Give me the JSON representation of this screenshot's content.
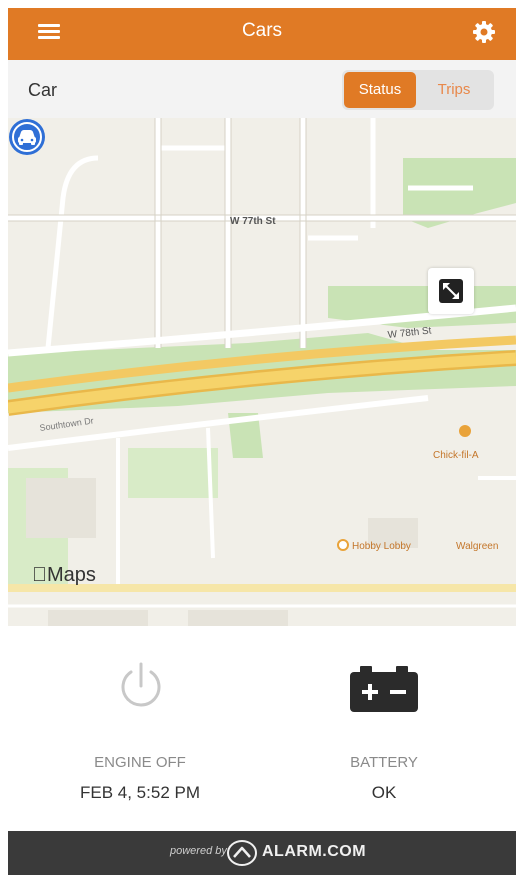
{
  "header": {
    "title": "Cars",
    "menu_icon": "menu-icon",
    "settings_icon": "gear-icon"
  },
  "subbar": {
    "label": "Car",
    "tabs": [
      {
        "label": "Status",
        "active": true
      },
      {
        "label": "Trips",
        "active": false
      }
    ]
  },
  "map": {
    "streets": [
      "W 77th St",
      "W 78th St",
      "Southtown Dr"
    ],
    "places": [
      "Chick-fil-A",
      "Hobby Lobby",
      "Walgreen"
    ],
    "attribution": "Maps",
    "expand_icon": "expand-icon",
    "car_icon": "car-icon"
  },
  "status": {
    "engine": {
      "label": "ENGINE OFF",
      "value": "FEB 4, 5:52 PM",
      "icon": "power-icon"
    },
    "battery": {
      "label": "BATTERY",
      "value": "OK",
      "icon": "battery-icon"
    }
  },
  "footer": {
    "powered_by": "powered by",
    "brand": "ALARM.COM"
  },
  "colors": {
    "accent": "#e07a25",
    "map_background": "#f1efe8",
    "park": "#c9e3b5",
    "highway": "#f2c94c",
    "footer": "#3a3a3a",
    "car_pin": "#2f6fd6"
  }
}
